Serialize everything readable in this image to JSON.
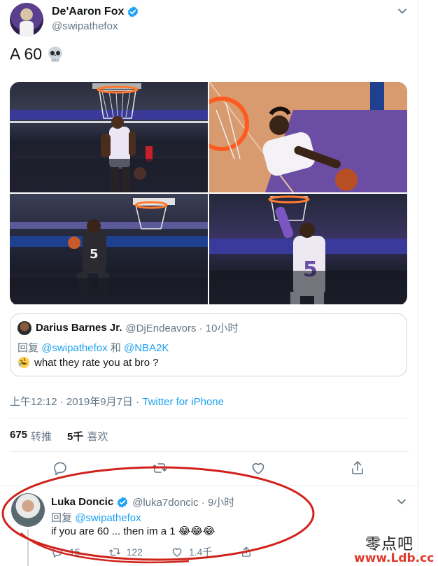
{
  "tweet": {
    "author_name": "De'Aaron Fox",
    "author_handle": "@swipathefox",
    "text": "A 60",
    "text_emoji": "skull-emoji",
    "photos": [
      "photo-1",
      "photo-2",
      "photo-3",
      "photo-4"
    ],
    "quoted": {
      "name": "Darius Barnes Jr.",
      "handle_time": "@DjEndeavors · 10小时",
      "reply_prefix": "回复",
      "reply_user1": "@swipathefox",
      "reply_and": "和",
      "reply_user2": "@NBA2K",
      "text": "what they rate you at bro ?"
    },
    "timestamp": "上午12:12 · 2019年9月7日 · ",
    "source": "Twitter for iPhone",
    "retweets_count": "675",
    "retweets_label": "转推",
    "likes_count": "5千",
    "likes_label": "喜欢"
  },
  "reply": {
    "name": "Luka Doncic",
    "handle_time": "@luka7doncic · 9小时",
    "reply_prefix": "回复",
    "reply_user": "@swipathefox",
    "text": "if you are 60 ... then im a 1 😂😂😂",
    "reply_count": "15",
    "retweet_count": "122",
    "like_count": "1.4千"
  },
  "watermark": {
    "text": "零点吧",
    "url": "www.Ldb.cc"
  },
  "colors": {
    "accent": "#1da1f2",
    "verified": "#1da1f2",
    "annotation": "#d0221b",
    "muted": "#657786"
  }
}
